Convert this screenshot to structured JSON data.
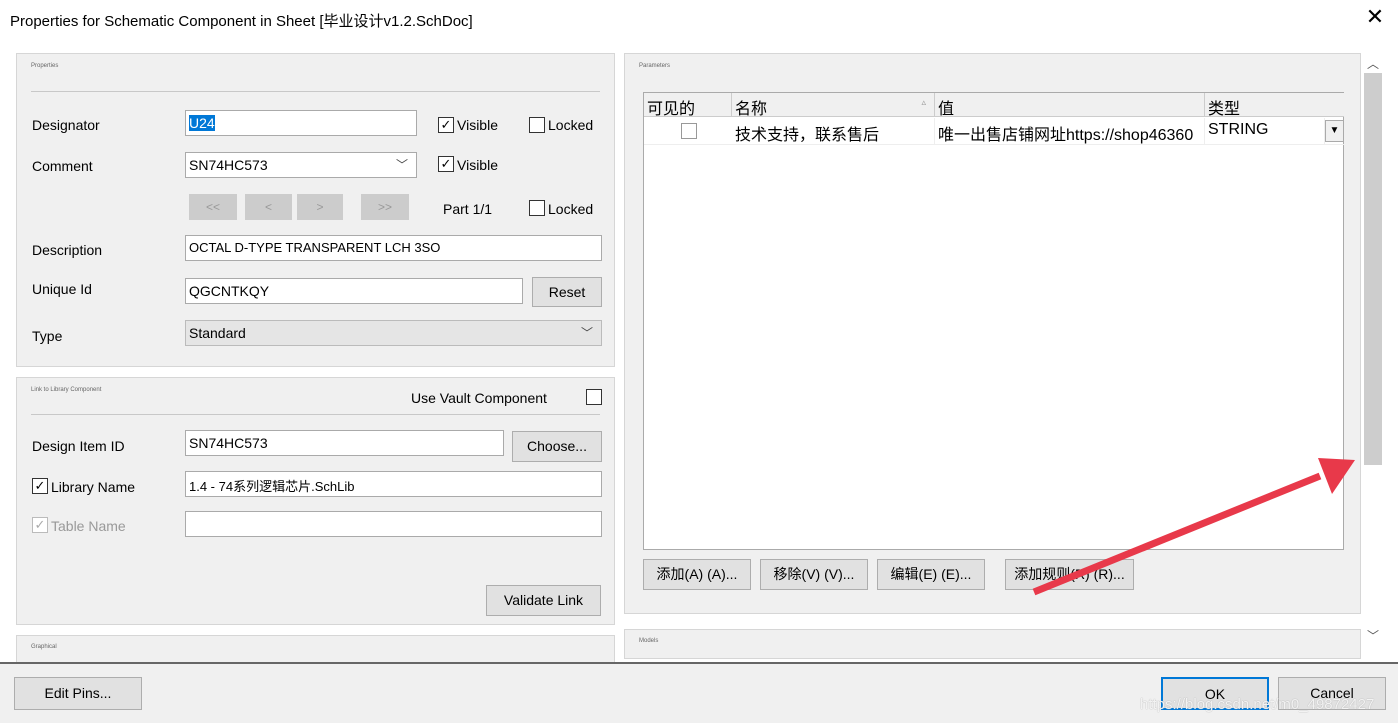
{
  "window": {
    "title": "Properties for Schematic Component in Sheet [毕业设计v1.2.SchDoc]",
    "close": "✕"
  },
  "properties": {
    "caption": "Properties",
    "designator_label": "Designator",
    "designator_value": "U24",
    "visible": "Visible",
    "locked": "Locked",
    "comment_label": "Comment",
    "comment_value": "SN74HC573",
    "nav": [
      "<<",
      "<",
      ">",
      ">>"
    ],
    "part": "Part 1/1",
    "description_label": "Description",
    "description_value": "OCTAL D-TYPE TRANSPARENT LCH 3SO",
    "unique_id_label": "Unique Id",
    "unique_id_value": "QGCNTKQY",
    "reset": "Reset",
    "type_label": "Type",
    "type_value": "Standard",
    "designator_visible": true,
    "comment_visible": true,
    "designator_locked": false,
    "part_locked": false
  },
  "library": {
    "caption": "Link to Library Component",
    "use_vault": "Use Vault Component",
    "use_vault_checked": false,
    "design_item_label": "Design Item ID",
    "design_item_value": "SN74HC573",
    "choose": "Choose...",
    "library_name_label": "Library Name",
    "library_name_checked": true,
    "library_name_value": "1.4 - 74系列逻辑芯片.SchLib",
    "table_name_label": "Table Name",
    "table_name_checked": true,
    "table_name_value": "",
    "validate": "Validate Link"
  },
  "graphical": {
    "caption": "Graphical"
  },
  "parameters": {
    "caption": "Parameters",
    "columns": [
      "可见的",
      "名称",
      "值",
      "类型"
    ],
    "rows": [
      {
        "visible": false,
        "name": "技术支持，联系售后",
        "value": "唯一出售店铺网址https://shop46360",
        "type": "STRING"
      }
    ],
    "buttons": [
      "添加(A) (A)...",
      "移除(V) (V)...",
      "编辑(E) (E)...",
      "添加规则(R) (R)..."
    ]
  },
  "models": {
    "caption": "Models"
  },
  "footer": {
    "edit_pins": "Edit Pins...",
    "ok": "OK",
    "cancel": "Cancel",
    "watermark": "https://blog.csdn.net/m0_49872427"
  },
  "colors": {
    "selection": "#0078d7",
    "arrow": "#e8394a",
    "ok_border": "#0078d7"
  }
}
